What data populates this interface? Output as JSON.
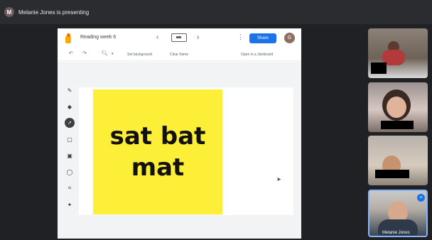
{
  "meeting": {
    "presenter_initial": "M",
    "presenting_text": "Melanie Jones is presenting"
  },
  "jamboard": {
    "title": "Reading week 6",
    "share_label": "Share",
    "user_initial": "G",
    "toolbar": {
      "set_background": "Set background",
      "clear_frame": "Clear frame",
      "open_jamboard": "Open in a Jamboard"
    },
    "sticky_note": {
      "line1": "sat bat",
      "line2": "mat"
    }
  },
  "participants": {
    "tile4_name": "Melanie Jones"
  },
  "colors": {
    "sticky": "#fdee38",
    "share_button": "#1a73e8",
    "active_tile_border": "#8ab4f8"
  }
}
